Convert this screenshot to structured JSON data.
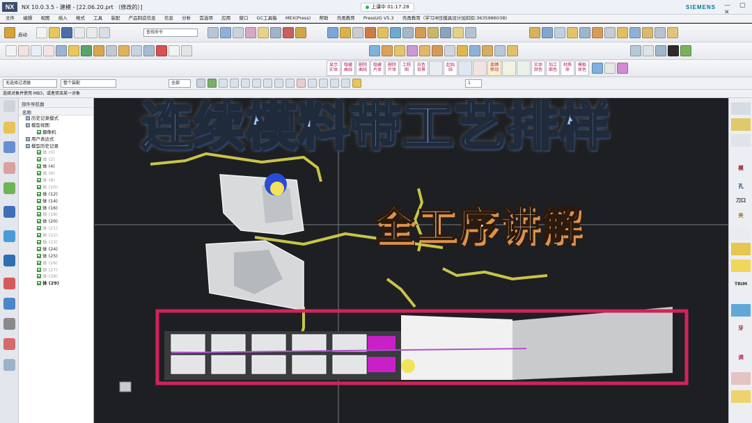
{
  "window": {
    "logo": "NX",
    "title": "NX 10.0.3.5 - 建模 - [22.06.20.prt （修改的）]",
    "live_status": "上课中 01:17:28",
    "brand": "SIEMENS",
    "controls": "— ▢ ✕"
  },
  "menu": [
    "文件",
    "编辑",
    "视图",
    "插入",
    "格式",
    "工具",
    "装配",
    "产品制造信息",
    "信息",
    "分析",
    "首选项",
    "应用",
    "窗口",
    "GC工具箱",
    "MEX(Press)",
    "帮助",
    "壳甬教育",
    "PressUG V5.3",
    "壳甬教育（学习冲压模具设计加扣扣:3635986038)"
  ],
  "toolbar": {
    "start_label": "启动",
    "command_search_placeholder": "查找命令",
    "big_buttons": [
      "显示实体",
      "隐藏曲线",
      "删除曲线",
      "隐藏片体",
      "删除片体",
      "工程图",
      "白色背景",
      "",
      "起始线",
      "",
      "",
      "束缚移动",
      "",
      "",
      "实体颜色",
      "加工面色",
      "材质体",
      "模板体色"
    ]
  },
  "selection": {
    "filter": "无选择过滤器",
    "scope": "整个装配",
    "mode": "全部",
    "count": "1"
  },
  "status_text": "选择对象并使用 MB3，或者双击某一对象",
  "navigator": {
    "title": "部件导航器",
    "column": "名称",
    "items": [
      {
        "label": "历史记录模式",
        "dim": false,
        "bold": false,
        "indent": 1,
        "kind": "folder"
      },
      {
        "label": "模型视图",
        "dim": false,
        "bold": false,
        "indent": 1,
        "kind": "folder"
      },
      {
        "label": "摄像机",
        "dim": false,
        "bold": false,
        "indent": 2,
        "kind": "check"
      },
      {
        "label": "用户表达式",
        "dim": false,
        "bold": false,
        "indent": 1,
        "kind": "folder"
      },
      {
        "label": "模型历史记录",
        "dim": false,
        "bold": false,
        "indent": 1,
        "kind": "folder"
      },
      {
        "label": "体 (0)",
        "dim": true,
        "bold": false,
        "indent": 2,
        "kind": "body"
      },
      {
        "label": "体 (2)",
        "dim": true,
        "bold": false,
        "indent": 2,
        "kind": "body"
      },
      {
        "label": "体 (4)",
        "dim": false,
        "bold": false,
        "indent": 2,
        "kind": "body"
      },
      {
        "label": "体 (6)",
        "dim": true,
        "bold": false,
        "indent": 2,
        "kind": "body"
      },
      {
        "label": "体 (8)",
        "dim": true,
        "bold": false,
        "indent": 2,
        "kind": "body"
      },
      {
        "label": "体 (10)",
        "dim": true,
        "bold": false,
        "indent": 2,
        "kind": "body"
      },
      {
        "label": "体 (12)",
        "dim": false,
        "bold": false,
        "indent": 2,
        "kind": "body"
      },
      {
        "label": "体 (14)",
        "dim": false,
        "bold": false,
        "indent": 2,
        "kind": "body"
      },
      {
        "label": "体 (16)",
        "dim": false,
        "bold": false,
        "indent": 2,
        "kind": "body"
      },
      {
        "label": "体 (18)",
        "dim": true,
        "bold": false,
        "indent": 2,
        "kind": "body"
      },
      {
        "label": "体 (20)",
        "dim": false,
        "bold": false,
        "indent": 2,
        "kind": "body"
      },
      {
        "label": "体 (21)",
        "dim": true,
        "bold": false,
        "indent": 2,
        "kind": "body"
      },
      {
        "label": "体 (22)",
        "dim": true,
        "bold": false,
        "indent": 2,
        "kind": "body"
      },
      {
        "label": "体 (23)",
        "dim": true,
        "bold": false,
        "indent": 2,
        "kind": "body"
      },
      {
        "label": "体 (24)",
        "dim": false,
        "bold": false,
        "indent": 2,
        "kind": "body"
      },
      {
        "label": "体 (25)",
        "dim": false,
        "bold": false,
        "indent": 2,
        "kind": "body"
      },
      {
        "label": "体 (26)",
        "dim": true,
        "bold": false,
        "indent": 2,
        "kind": "body"
      },
      {
        "label": "体 (27)",
        "dim": true,
        "bold": false,
        "indent": 2,
        "kind": "body"
      },
      {
        "label": "体 (28)",
        "dim": true,
        "bold": false,
        "indent": 2,
        "kind": "body"
      },
      {
        "label": "体 (29)",
        "dim": false,
        "bold": true,
        "indent": 2,
        "kind": "body"
      }
    ]
  },
  "resource_bar": [
    "模",
    "孔",
    "刀口",
    "夹",
    "TRIM",
    "牙",
    "调"
  ],
  "overlay": {
    "headline": "连续模料带工艺排样",
    "subheadline": "全工序讲解"
  },
  "colors": {
    "viewport_bg": "#1e1f22",
    "highlight_frame": "#d0235a",
    "headline_fill": "#9fc2f2",
    "subheadline_shadow": "#e0924a",
    "magenta_faces": "#c81fc8",
    "yellow_curves": "#c9c44a"
  }
}
